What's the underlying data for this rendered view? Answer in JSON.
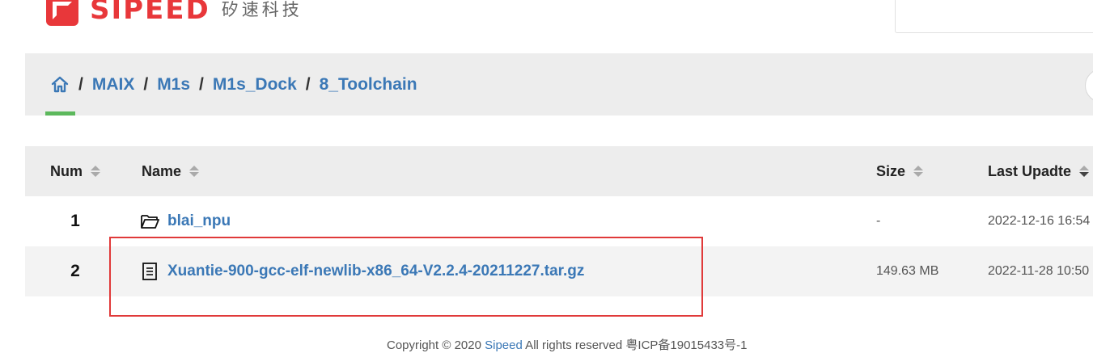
{
  "header": {
    "logo_text": "SIPEED",
    "logo_cn": "矽速科技"
  },
  "breadcrumb": {
    "items": [
      "MAIX",
      "M1s",
      "M1s_Dock",
      "8_Toolchain"
    ],
    "separator": "/"
  },
  "table": {
    "columns": [
      "Num",
      "Name",
      "Size",
      "Last Upadte"
    ],
    "rows": [
      {
        "num": "1",
        "name": "blai_npu",
        "size": "-",
        "date": "2022-12-16 16:54",
        "type": "folder-icon"
      },
      {
        "num": "2",
        "name": "Xuantie-900-gcc-elf-newlib-x86_64-V2.2.4-20211227.tar.gz",
        "size": "149.63 MB",
        "date": "2022-11-28 10:50",
        "type": "file-icon"
      }
    ]
  },
  "footer": {
    "text_prefix": "Copyright © 2020 ",
    "link": "Sipeed",
    "text_suffix": " All rights reserved 粤ICP备19015433号-1"
  },
  "colors": {
    "brand": "#e8373a",
    "link": "#3b78b6",
    "highlight": "#e03a3a",
    "home_underline": "#5cb85c"
  }
}
